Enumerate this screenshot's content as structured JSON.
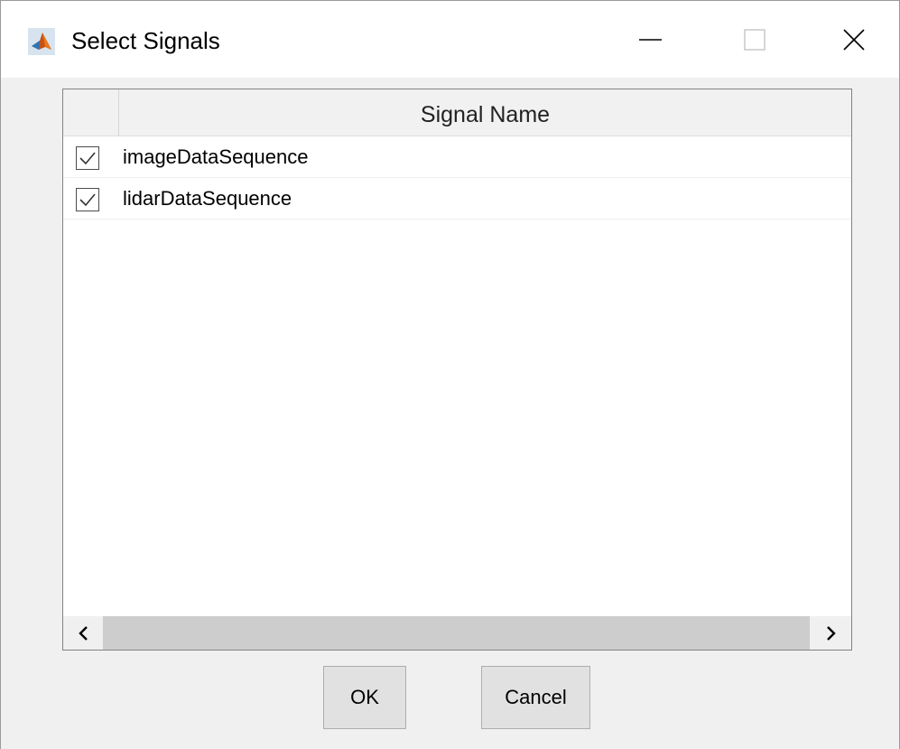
{
  "window": {
    "title": "Select Signals",
    "icon": "matlab-icon",
    "controls": [
      "minimize-icon",
      "maximize-icon",
      "close-icon"
    ]
  },
  "table": {
    "columns": [
      "",
      "Signal Name"
    ],
    "rows": [
      {
        "checked": true,
        "name": "imageDataSequence"
      },
      {
        "checked": true,
        "name": "lidarDataSequence"
      }
    ]
  },
  "buttons": {
    "ok_label": "OK",
    "cancel_label": "Cancel"
  },
  "colors": {
    "title_bar": "#ffffff",
    "dialog_bg": "#f0f0f0",
    "scroll_thumb": "#cdcdcd",
    "button_bg": "#e1e1e1"
  }
}
